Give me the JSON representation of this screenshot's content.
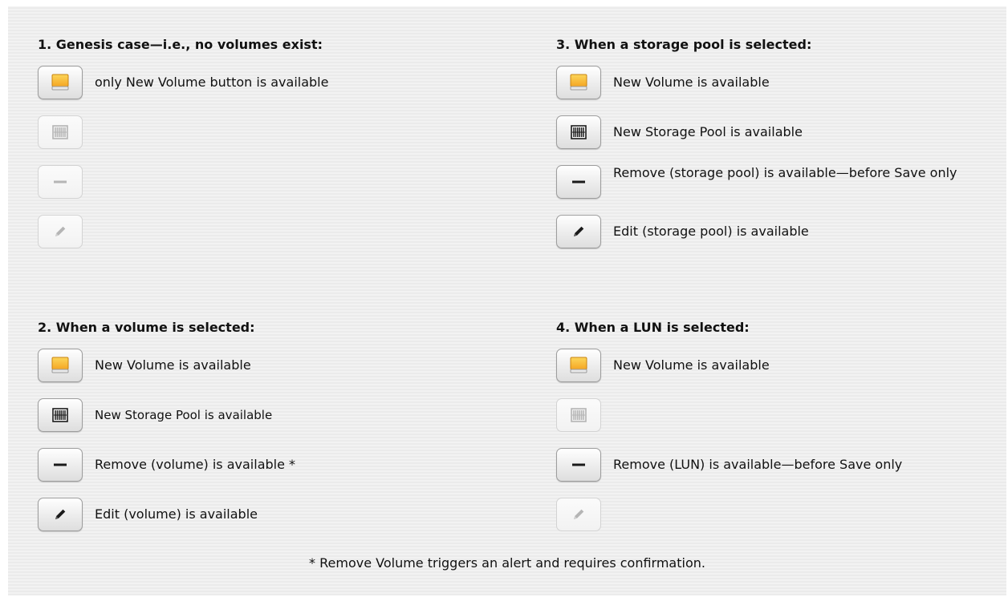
{
  "sections": [
    {
      "heading": "1. Genesis case—i.e., no volumes exist:",
      "rows": [
        {
          "icon": "volume-icon",
          "enabled": true,
          "text": "only New Volume button is available"
        },
        {
          "icon": "storage-pool-icon",
          "enabled": false,
          "text": ""
        },
        {
          "icon": "remove-icon",
          "enabled": false,
          "text": ""
        },
        {
          "icon": "edit-pencil-icon",
          "enabled": false,
          "text": ""
        }
      ]
    },
    {
      "heading": "2. When a volume is selected:",
      "rows": [
        {
          "icon": "volume-icon",
          "enabled": true,
          "text": "New Volume is available"
        },
        {
          "icon": "storage-pool-icon",
          "enabled": true,
          "text": "New Storage Pool is available"
        },
        {
          "icon": "remove-icon",
          "enabled": true,
          "text": "Remove (volume) is available *"
        },
        {
          "icon": "edit-pencil-icon",
          "enabled": true,
          "text": "Edit (volume) is available"
        }
      ]
    },
    {
      "heading": "3. When a storage pool is selected:",
      "rows": [
        {
          "icon": "volume-icon",
          "enabled": true,
          "text": "New Volume is available"
        },
        {
          "icon": "storage-pool-icon",
          "enabled": true,
          "text": "New Storage Pool is available"
        },
        {
          "icon": "remove-icon",
          "enabled": true,
          "text": "Remove (storage pool) is available—before Save only"
        },
        {
          "icon": "edit-pencil-icon",
          "enabled": true,
          "text": "Edit (storage pool) is available"
        }
      ]
    },
    {
      "heading": "4. When a LUN is selected:",
      "rows": [
        {
          "icon": "volume-icon",
          "enabled": true,
          "text": "New Volume is available"
        },
        {
          "icon": "storage-pool-icon",
          "enabled": false,
          "text": ""
        },
        {
          "icon": "remove-icon",
          "enabled": true,
          "text": "Remove (LUN) is available—before Save only"
        },
        {
          "icon": "edit-pencil-icon",
          "enabled": false,
          "text": ""
        }
      ]
    }
  ],
  "footnote": "* Remove Volume triggers an alert and requires confirmation.",
  "colors": {
    "volume_orange": "#f5a623",
    "volume_yellow": "#fcd65a",
    "enabled_glyph": "#1a1a1a",
    "disabled_glyph": "#b5b5b5"
  }
}
